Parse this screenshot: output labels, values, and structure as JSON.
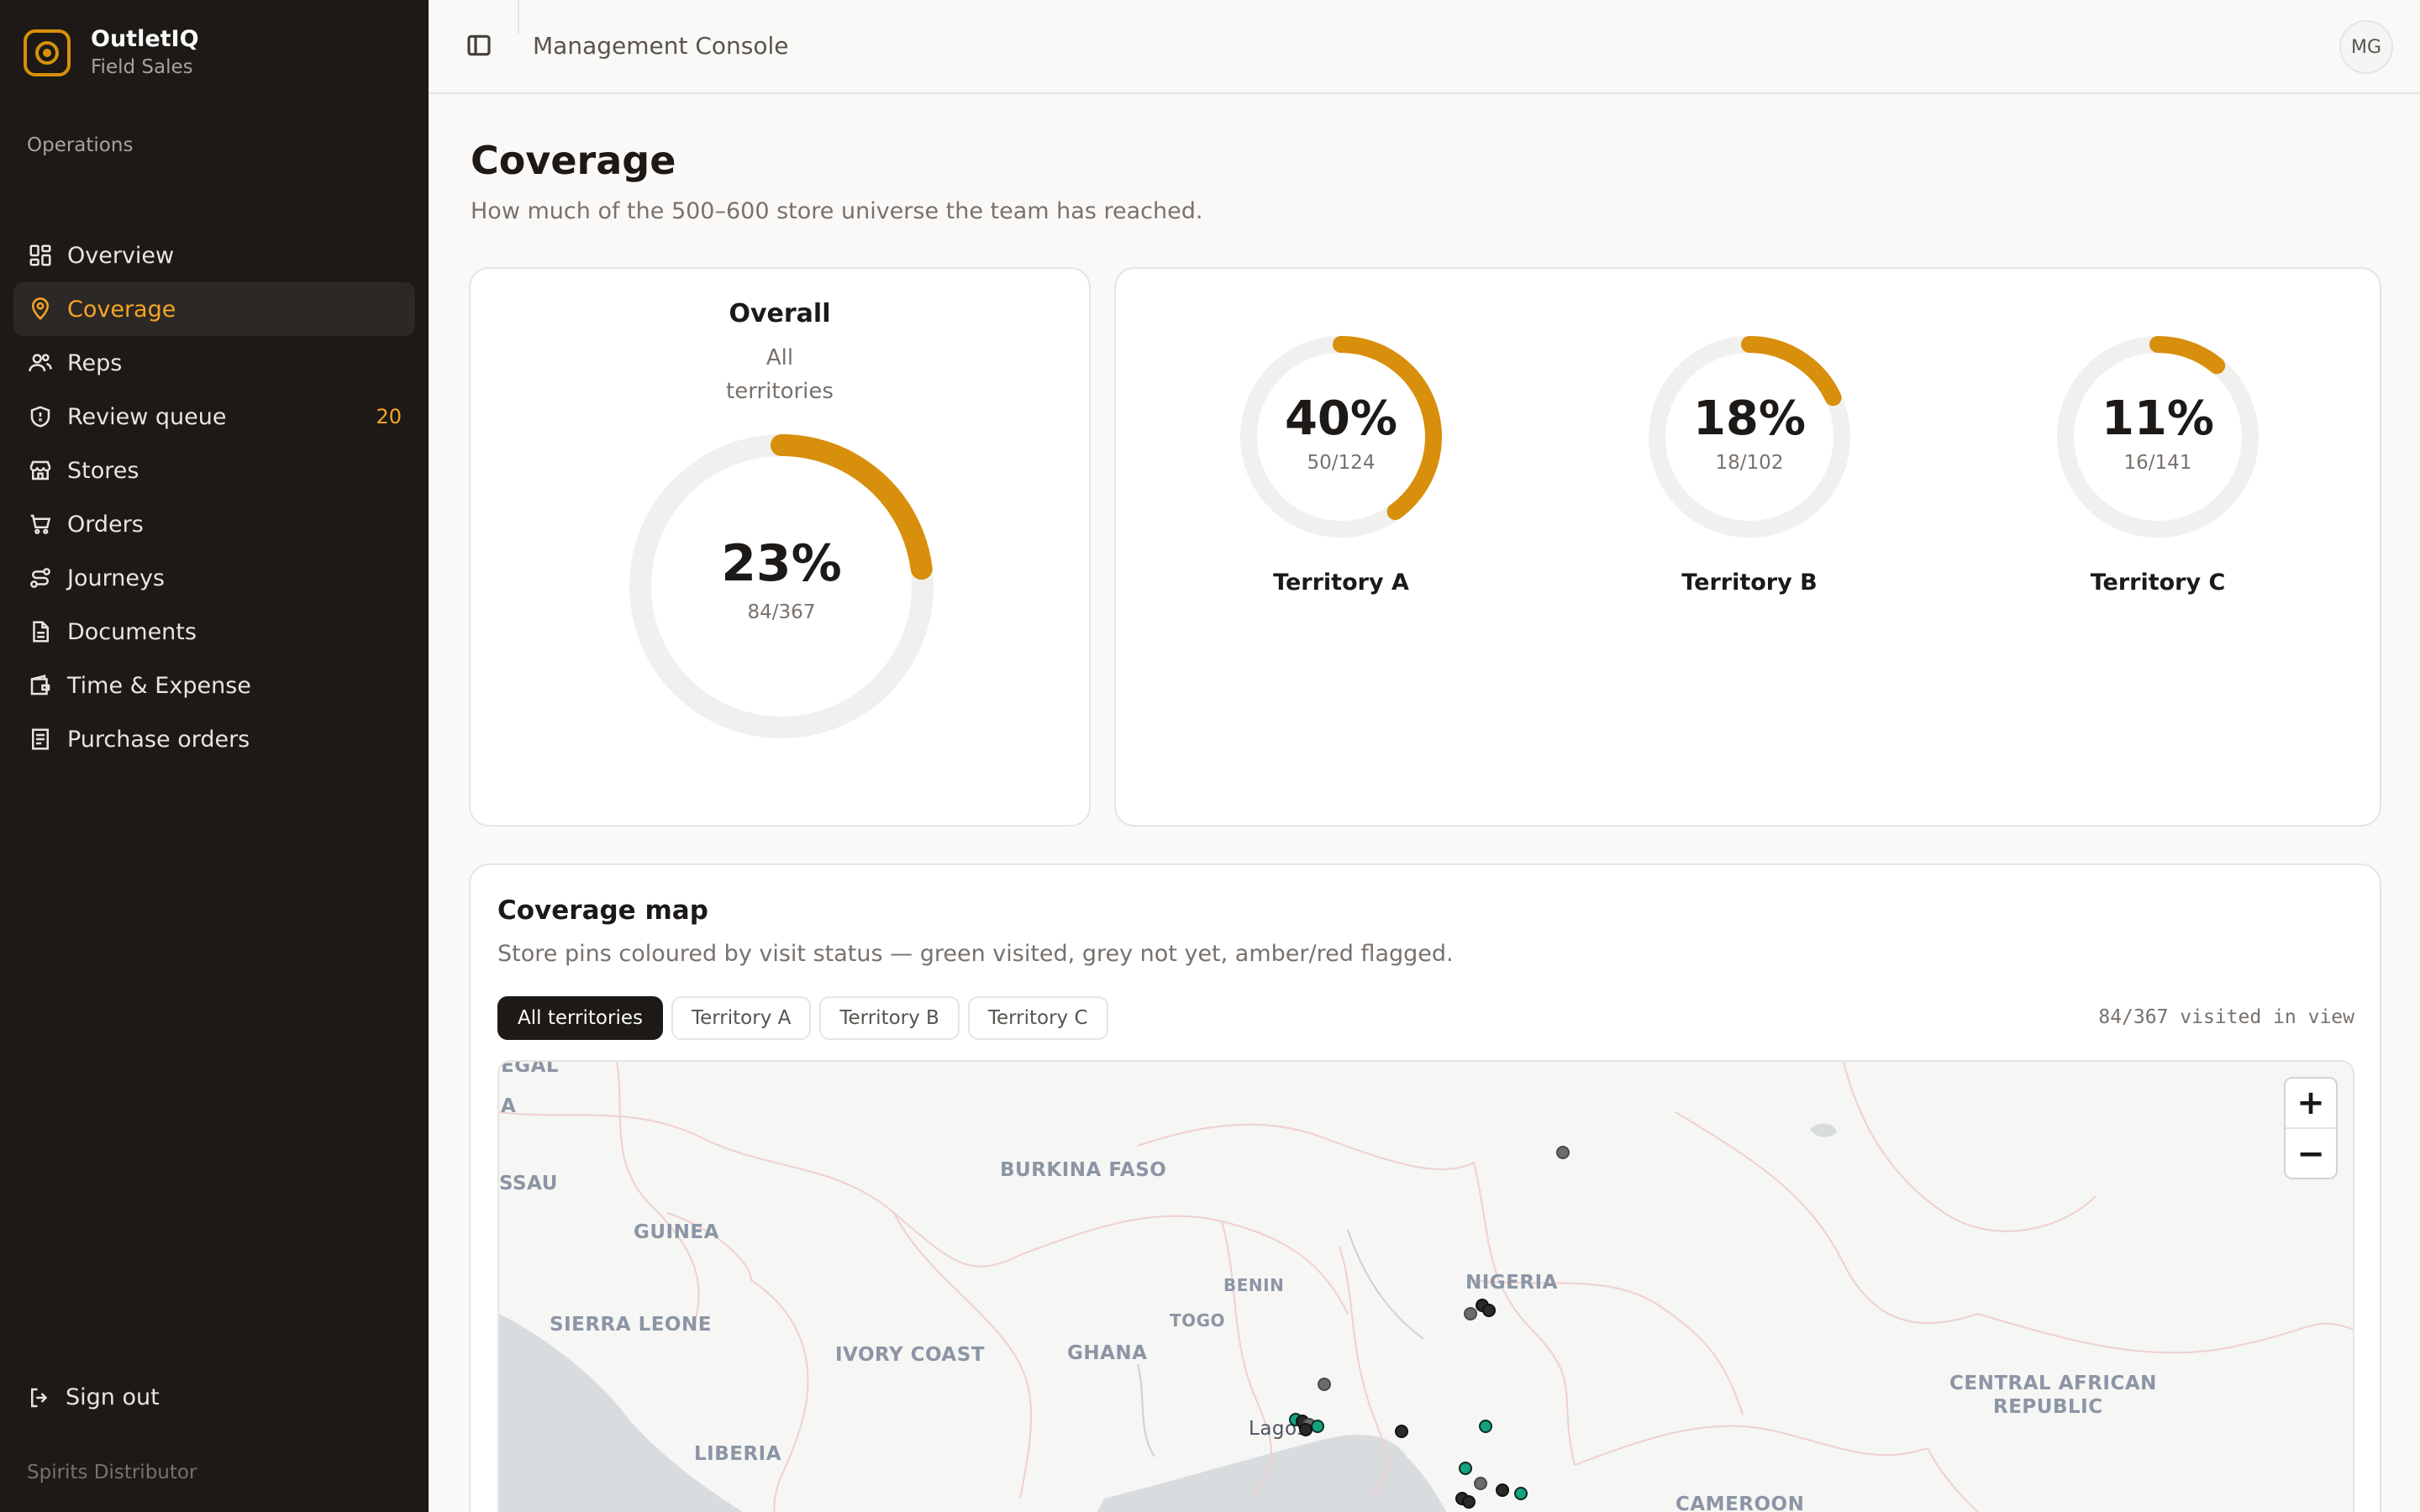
{
  "brand": {
    "name": "OutletIQ",
    "subtitle": "Field Sales",
    "accent": "#d88f0c"
  },
  "sidebar": {
    "section_label": "Operations",
    "items": [
      {
        "label": "Overview",
        "icon": "dashboard-icon"
      },
      {
        "label": "Coverage",
        "icon": "map-pin-icon",
        "active": true
      },
      {
        "label": "Reps",
        "icon": "users-icon"
      },
      {
        "label": "Review queue",
        "icon": "shield-icon",
        "badge": "20"
      },
      {
        "label": "Stores",
        "icon": "store-icon"
      },
      {
        "label": "Orders",
        "icon": "cart-icon"
      },
      {
        "label": "Journeys",
        "icon": "route-icon"
      },
      {
        "label": "Documents",
        "icon": "document-icon"
      },
      {
        "label": "Time & Expense",
        "icon": "wallet-icon"
      },
      {
        "label": "Purchase orders",
        "icon": "receipt-icon"
      }
    ],
    "sign_out": "Sign out",
    "footer": "Spirits Distributor"
  },
  "topbar": {
    "title": "Management Console",
    "avatar": "MG"
  },
  "page": {
    "title": "Coverage",
    "subtitle": "How much of the 500–600 store universe the team has reached."
  },
  "overall": {
    "title": "Overall",
    "desc_line1": "All",
    "desc_line2": "territories",
    "percent_label": "23%",
    "fraction": "84/367",
    "value": 0.23
  },
  "territories": [
    {
      "name": "Territory A",
      "percent_label": "40%",
      "fraction": "50/124",
      "value": 0.4
    },
    {
      "name": "Territory B",
      "percent_label": "18%",
      "fraction": "18/102",
      "value": 0.18
    },
    {
      "name": "Territory C",
      "percent_label": "11%",
      "fraction": "16/141",
      "value": 0.11
    }
  ],
  "map": {
    "title": "Coverage map",
    "subtitle": "Store pins coloured by visit status — green visited, grey not yet, amber/red flagged.",
    "filters": [
      "All territories",
      "Territory A",
      "Territory B",
      "Territory C"
    ],
    "active_filter": "All territories",
    "visited_in_view": "84/367 visited in view",
    "zoom_in": "+",
    "zoom_out": "−",
    "labels": {
      "l1": "EGAL",
      "l2": "A",
      "l3": "SSAU",
      "burkina": "BURKINA FASO",
      "guinea": "GUINEA",
      "sierra": "SIERRA LEONE",
      "ivory": "IVORY COAST",
      "ghana": "GHANA",
      "togo": "TOGO",
      "benin": "BENIN",
      "nigeria": "NIGERIA",
      "liberia": "LIBERIA",
      "lagos": "Lagos",
      "car1": "CENTRAL AFRICAN",
      "car2": "REPUBLIC",
      "cameroon": "CAMEROON"
    }
  }
}
